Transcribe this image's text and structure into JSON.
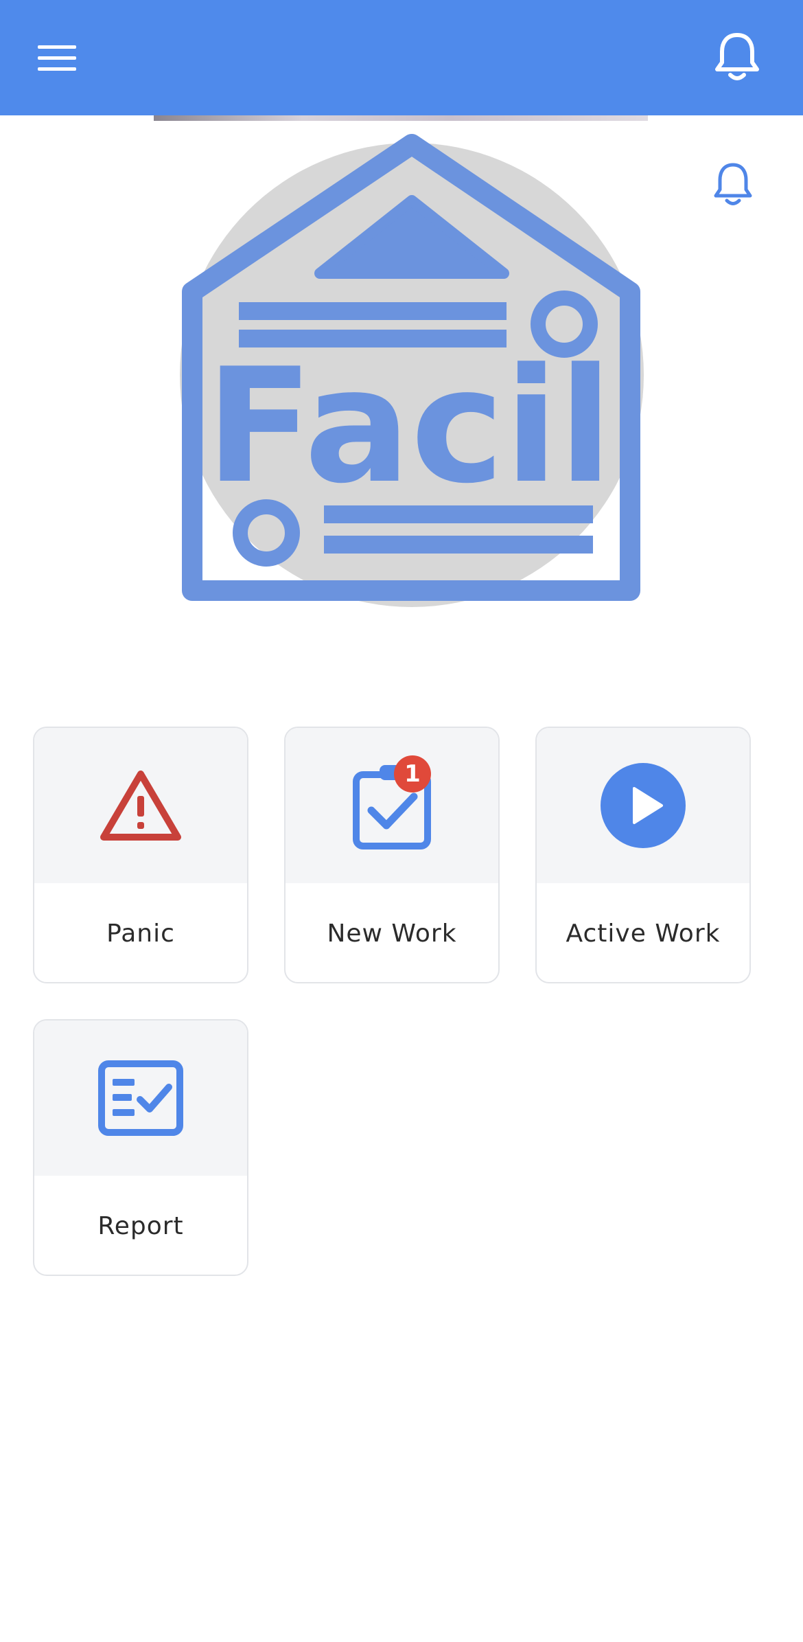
{
  "app_bar": {
    "menu_icon": "hamburger-menu-icon",
    "bell_icon": "bell-icon"
  },
  "brand": {
    "logo_text": "Facil"
  },
  "tiles": [
    {
      "label": "Panic",
      "icon": "warning-triangle-icon",
      "color": "#c8413a"
    },
    {
      "label": "New Work",
      "icon": "clipboard-check-icon",
      "color": "#4f86e8",
      "badge": "1"
    },
    {
      "label": "Active Work",
      "icon": "play-circle-icon",
      "color": "#4f86e8"
    },
    {
      "label": "Report",
      "icon": "report-checklist-icon",
      "color": "#4f86e8"
    }
  ],
  "colors": {
    "primary": "#4f8aeb",
    "danger": "#c8413a",
    "badge": "#e0493a",
    "logo": "#6b93de"
  }
}
